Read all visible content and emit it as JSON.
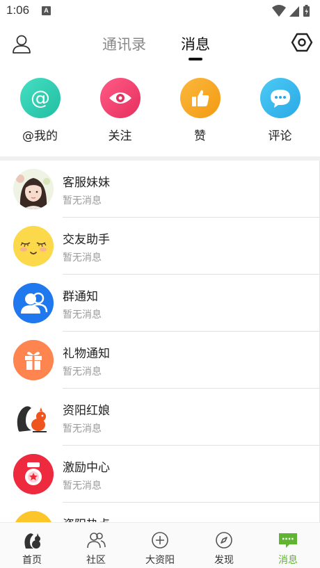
{
  "status_bar": {
    "time": "1:06",
    "notification_letter": "A"
  },
  "top_nav": {
    "tabs": [
      {
        "label": "通讯录",
        "active": false
      },
      {
        "label": "消息",
        "active": true
      }
    ]
  },
  "categories": [
    {
      "label": "@我的",
      "icon": "at-icon",
      "color": "#2fcfb2"
    },
    {
      "label": "关注",
      "icon": "eye-icon",
      "color": "#f2436f"
    },
    {
      "label": "赞",
      "icon": "thumbs-up-icon",
      "color": "#f6a623"
    },
    {
      "label": "评论",
      "icon": "chat-bubble-icon",
      "color": "#36b9ee"
    }
  ],
  "messages": [
    {
      "title": "客服妹妹",
      "subtitle": "暂无消息",
      "avatar": "girl-photo-avatar"
    },
    {
      "title": "交友助手",
      "subtitle": "暂无消息",
      "avatar": "smiley-face-avatar"
    },
    {
      "title": "群通知",
      "subtitle": "暂无消息",
      "avatar": "group-people-avatar"
    },
    {
      "title": "礼物通知",
      "subtitle": "暂无消息",
      "avatar": "gift-box-avatar"
    },
    {
      "title": "资阳红娘",
      "subtitle": "暂无消息",
      "avatar": "squirrel-avatar"
    },
    {
      "title": "激励中心",
      "subtitle": "暂无消息",
      "avatar": "medal-avatar"
    },
    {
      "title": "资阳热点",
      "subtitle": "",
      "avatar": "squirrel-yellow-avatar"
    }
  ],
  "bottom_nav": [
    {
      "label": "首页",
      "icon": "squirrel-home-icon",
      "active": false
    },
    {
      "label": "社区",
      "icon": "community-icon",
      "active": false
    },
    {
      "label": "大资阳",
      "icon": "plus-circle-icon",
      "active": false
    },
    {
      "label": "发现",
      "icon": "compass-icon",
      "active": false
    },
    {
      "label": "消息",
      "icon": "message-icon",
      "active": true
    }
  ],
  "colors": {
    "accent_green": "#5fb531"
  }
}
